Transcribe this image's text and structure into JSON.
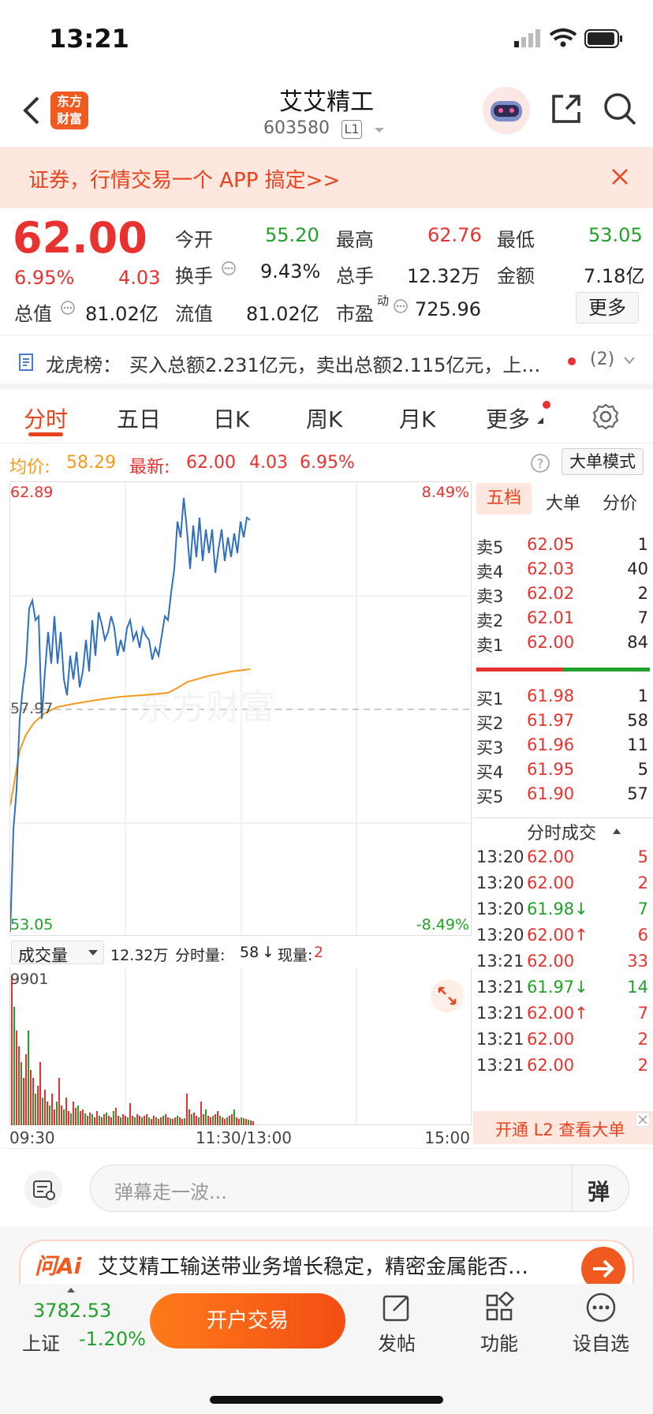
{
  "status": {
    "time": "13:21"
  },
  "nav": {
    "title": "艾艾精工",
    "code": "603580",
    "level": "L1",
    "logo_top": "东方",
    "logo_bottom": "财富"
  },
  "banner": {
    "text": "证券，行情交易一个 APP 搞定>>"
  },
  "quote": {
    "price": "62.00",
    "pct": "6.95%",
    "chg": "4.03",
    "open_l": "今开",
    "open": "55.20",
    "high_l": "最高",
    "high": "62.76",
    "low_l": "最低",
    "low": "53.05",
    "turn_l": "换手",
    "turn": "9.43%",
    "vol_l": "总手",
    "vol": "12.32万",
    "amt_l": "金额",
    "amt": "7.18亿",
    "cap_l": "总值",
    "cap": "81.02亿",
    "float_l": "流值",
    "float": "81.02亿",
    "pe_l": "市盈",
    "pe_sup": "动",
    "pe": "725.96",
    "more": "更多"
  },
  "dragon": {
    "label": "龙虎榜：",
    "text": "买入总额2.231亿元，卖出总额2.115亿元，上…",
    "count": "(2)"
  },
  "tabs": [
    "分时",
    "五日",
    "日K",
    "周K",
    "月K",
    "更多"
  ],
  "info": {
    "avg_l": "均价:",
    "avg": "58.29",
    "last_l": "最新:",
    "last": "62.00",
    "chg": "4.03",
    "pct": "6.95%",
    "mode": "大单模式"
  },
  "chart": {
    "top_price": "62.89",
    "top_pct": "8.49%",
    "mid_price": "57.97",
    "bot_price": "53.05",
    "bot_pct": "-8.49%",
    "watermark": "东方财富"
  },
  "vol": {
    "label": "成交量",
    "total": "12.32万",
    "fen_l": "分时量:",
    "fen": "58",
    "now_l": "现量:",
    "now": "2",
    "max": "9901"
  },
  "time_axis": [
    "09:30",
    "11:30/13:00",
    "15:00"
  ],
  "rpanel": {
    "tabs": [
      "五档",
      "大单",
      "分价"
    ],
    "asks": [
      {
        "l": "卖5",
        "p": "62.05",
        "v": "1"
      },
      {
        "l": "卖4",
        "p": "62.03",
        "v": "40"
      },
      {
        "l": "卖3",
        "p": "62.02",
        "v": "2"
      },
      {
        "l": "卖2",
        "p": "62.01",
        "v": "7"
      },
      {
        "l": "卖1",
        "p": "62.00",
        "v": "84"
      }
    ],
    "bids": [
      {
        "l": "买1",
        "p": "61.98",
        "v": "1"
      },
      {
        "l": "买2",
        "p": "61.97",
        "v": "58"
      },
      {
        "l": "买3",
        "p": "61.96",
        "v": "11"
      },
      {
        "l": "买4",
        "p": "61.95",
        "v": "5"
      },
      {
        "l": "买5",
        "p": "61.90",
        "v": "57"
      }
    ],
    "ticks_title": "分时成交",
    "ticks": [
      {
        "t": "13:20",
        "p": "62.00",
        "v": "5",
        "c": "red"
      },
      {
        "t": "13:20",
        "p": "62.00",
        "v": "2",
        "c": "red"
      },
      {
        "t": "13:20",
        "p": "61.98↓",
        "v": "7",
        "c": "green"
      },
      {
        "t": "13:20",
        "p": "62.00↑",
        "v": "6",
        "c": "red"
      },
      {
        "t": "13:21",
        "p": "62.00",
        "v": "33",
        "c": "red"
      },
      {
        "t": "13:21",
        "p": "61.97↓",
        "v": "14",
        "c": "green"
      },
      {
        "t": "13:21",
        "p": "62.00↑",
        "v": "7",
        "c": "red"
      },
      {
        "t": "13:21",
        "p": "62.00",
        "v": "2",
        "c": "red"
      },
      {
        "t": "13:21",
        "p": "62.00",
        "v": "2",
        "c": "red"
      }
    ],
    "l2": "开通 L2 查看大单"
  },
  "comment": {
    "placeholder": "弹幕走一波...",
    "dan": "弹"
  },
  "ai": {
    "logo": "问Ai",
    "text": "艾艾精工输送带业务增长稳定，精密金属能否…"
  },
  "bottom": {
    "index": "3782.53",
    "index_name": "上证",
    "index_pct": "-1.20%",
    "trade": "开户交易",
    "post": "发帖",
    "func": "功能",
    "fav": "设自选"
  }
}
